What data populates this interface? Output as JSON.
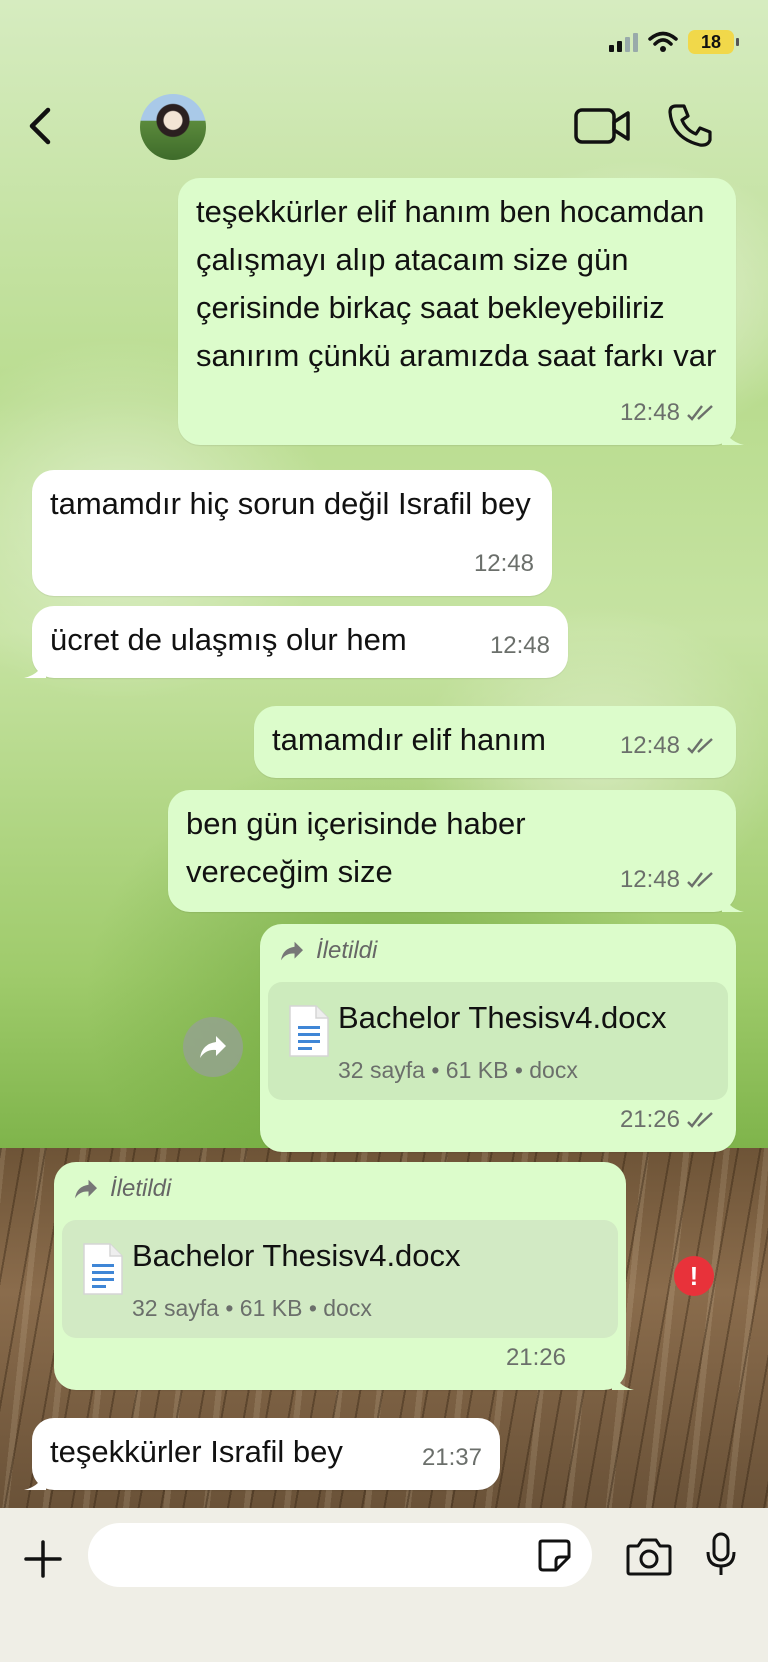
{
  "status_bar": {
    "battery": "18"
  },
  "header": {
    "contact_name": ""
  },
  "messages": [
    {
      "direction": "out",
      "text": "teşekkürler elif hanım ben hocamdan çalışmayı alıp atacaım size gün çerisinde birkaç saat bekleyebiliriz sanırım çünkü aramızda saat farkı var",
      "time": "12:48",
      "status": "read"
    },
    {
      "direction": "in",
      "text": "tamamdır hiç sorun değil Israfil bey",
      "time": "12:48"
    },
    {
      "direction": "in",
      "text": "ücret de ulaşmış olur hem",
      "time": "12:48"
    },
    {
      "direction": "out",
      "text": "tamamdır elif hanım",
      "time": "12:48",
      "status": "read"
    },
    {
      "direction": "out",
      "text": "ben gün içerisinde haber vereceğim size",
      "time": "12:48",
      "status": "read"
    },
    {
      "direction": "out",
      "forwarded_label": "İletildi",
      "document": {
        "name": "Bachelor Thesisv4.docx",
        "info": "32 sayfa • 61 KB • docx"
      },
      "time": "21:26",
      "status": "read"
    },
    {
      "direction": "out",
      "forwarded_label": "İletildi",
      "document": {
        "name": "Bachelor Thesisv4.docx",
        "info": "32 sayfa • 61 KB • docx"
      },
      "time": "21:26",
      "status": "failed"
    },
    {
      "direction": "in",
      "text": "teşekkürler Israfil bey",
      "time": "21:37"
    }
  ],
  "composer": {
    "placeholder": ""
  },
  "icons": {
    "back": "chevron-left-icon",
    "video": "video-camera-icon",
    "call": "phone-icon",
    "forward": "forward-arrow-icon",
    "document": "document-icon",
    "error": "error-icon",
    "plus": "plus-icon",
    "sticker": "sticker-icon",
    "camera": "camera-icon",
    "mic": "microphone-icon"
  },
  "colors": {
    "outgoing_bubble": "#dcfccb",
    "incoming_bubble": "#ffffff",
    "error": "#e8323a",
    "battery": "#f1d84a"
  }
}
